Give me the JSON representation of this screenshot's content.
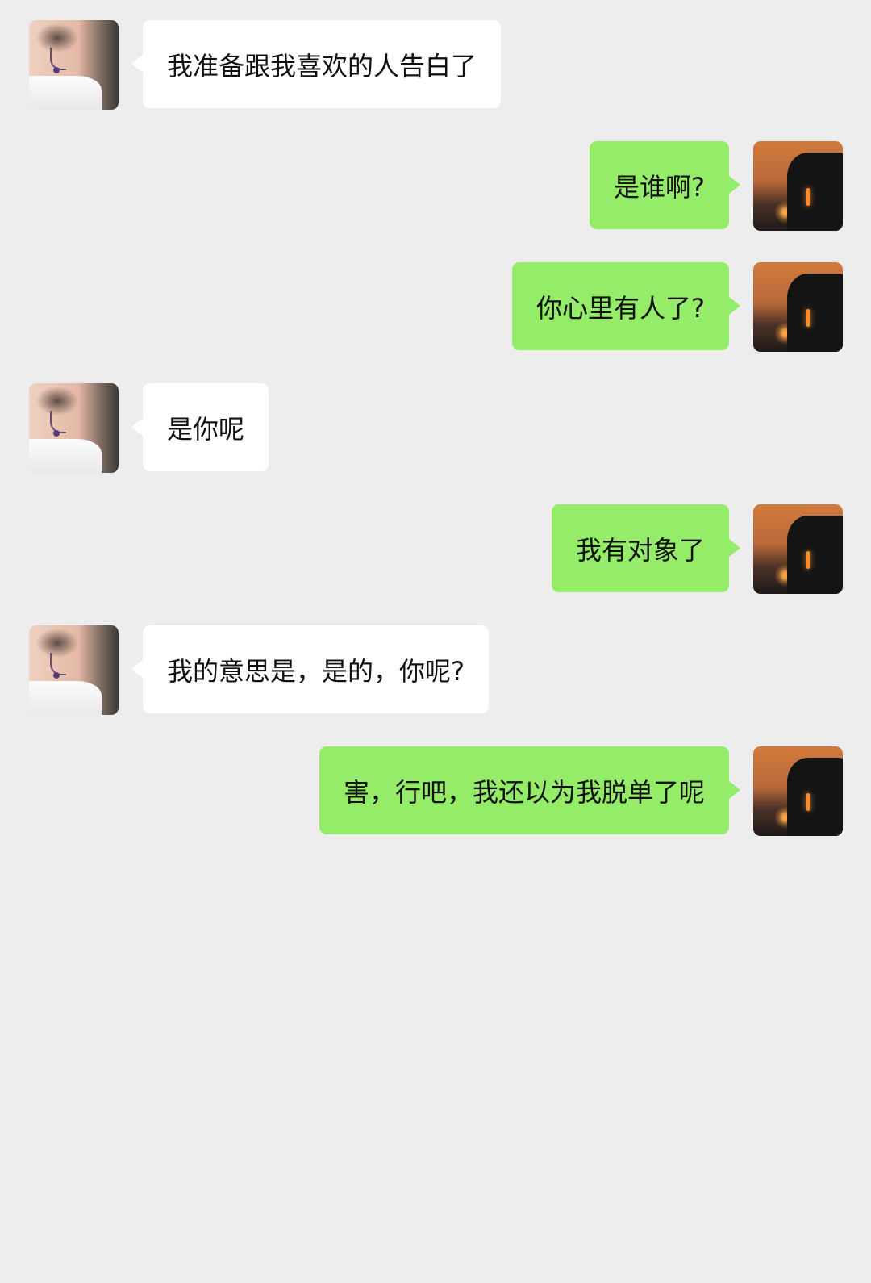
{
  "colors": {
    "background": "#ededed",
    "incoming_bubble": "#ffffff",
    "outgoing_bubble": "#95ec69",
    "text": "#111111"
  },
  "messages": [
    {
      "from": "contact",
      "avatar": "contact-avatar-icon",
      "text": "我准备跟我喜欢的人告白了"
    },
    {
      "from": "me",
      "avatar": "my-avatar-icon",
      "text": "是谁啊?"
    },
    {
      "from": "me",
      "avatar": "my-avatar-icon",
      "text": "你心里有人了?"
    },
    {
      "from": "contact",
      "avatar": "contact-avatar-icon",
      "text": "是你呢"
    },
    {
      "from": "me",
      "avatar": "my-avatar-icon",
      "text": "我有对象了"
    },
    {
      "from": "contact",
      "avatar": "contact-avatar-icon",
      "text": "我的意思是，是的，你呢?"
    },
    {
      "from": "me",
      "avatar": "my-avatar-icon",
      "text": "害，行吧，我还以为我脱单了呢"
    }
  ]
}
